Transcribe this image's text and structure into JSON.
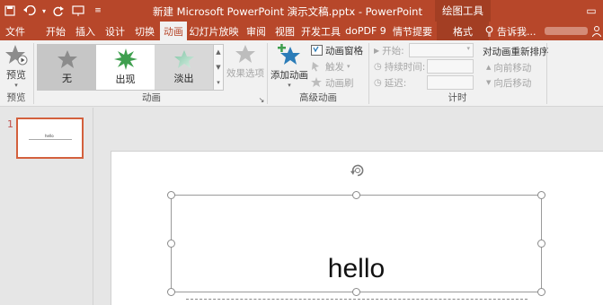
{
  "titlebar": {
    "doc_title": "新建 Microsoft PowerPoint 演示文稿.pptx - PowerPoint",
    "contextual_group": "绘图工具",
    "bg_color": "#b7472a"
  },
  "qat": {
    "icons": [
      "save-icon",
      "undo-icon",
      "redo-icon",
      "present-from-start-icon",
      "customize-qat-icon"
    ]
  },
  "tabs": {
    "file": "文件",
    "home": "开始",
    "insert": "插入",
    "design": "设计",
    "transitions": "切换",
    "animations": "动画",
    "slideshow": "幻灯片放映",
    "review": "审阅",
    "view": "视图",
    "developer": "开发工具",
    "dopdf": "doPDF 9",
    "storyboard": "情节提要",
    "format": "格式",
    "active": "动画"
  },
  "tellme": {
    "label": "告诉我..."
  },
  "ribbon": {
    "preview": {
      "button": "预览",
      "group": "预览"
    },
    "animation": {
      "group": "动画",
      "gallery": [
        {
          "label": "无",
          "state": "selected"
        },
        {
          "label": "出现",
          "state": "normal"
        },
        {
          "label": "淡出",
          "state": "hover"
        }
      ],
      "effect_options": "效果选项"
    },
    "advanced": {
      "group": "高级动画",
      "add_animation": "添加动画",
      "animation_pane": "动画窗格",
      "trigger": "触发",
      "painter": "动画刷"
    },
    "timing": {
      "group": "计时",
      "start": "开始:",
      "duration": "持续时间:",
      "delay": "延迟:",
      "reorder_title": "对动画重新排序",
      "move_earlier": "向前移动",
      "move_later": "向后移动"
    }
  },
  "slides_pane": {
    "slide_number": "1",
    "thumb_title": "hello"
  },
  "slide": {
    "title_text": "hello"
  }
}
